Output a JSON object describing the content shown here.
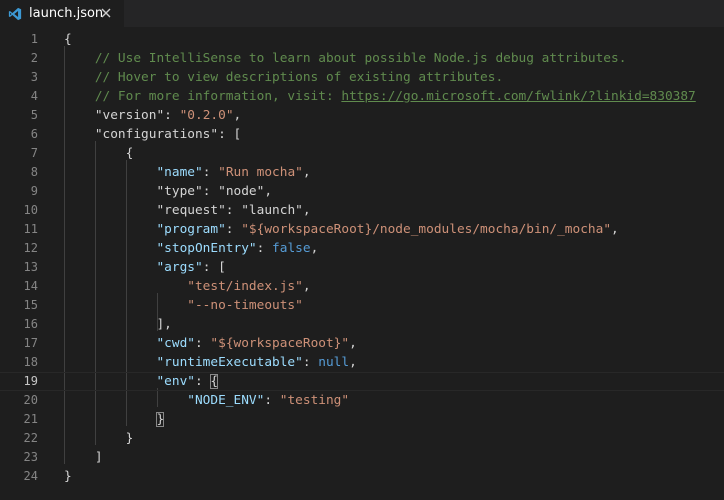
{
  "tab": {
    "filename": "launch.json",
    "icon": "vscode-logo-icon",
    "close_icon": "close-icon"
  },
  "colors": {
    "editor_bg": "#1e1e1e",
    "comment": "#608b4e",
    "key": "#9cdcfe",
    "string": "#ce9178",
    "keyword": "#569cd6",
    "line_number": "#858585"
  },
  "editor": {
    "current_line": 19,
    "lines": [
      {
        "n": "1",
        "tokens": [
          {
            "t": "{",
            "c": "p"
          }
        ]
      },
      {
        "n": "2",
        "tokens": [
          {
            "t": "    // Use IntelliSense to learn about possible Node.js debug attributes.",
            "c": "c"
          }
        ]
      },
      {
        "n": "3",
        "tokens": [
          {
            "t": "    // Hover to view descriptions of existing attributes.",
            "c": "c"
          }
        ]
      },
      {
        "n": "4",
        "tokens": [
          {
            "t": "    // For more information, visit: ",
            "c": "c"
          },
          {
            "t": "https://go.microsoft.com/fwlink/?linkid=830387",
            "c": "lnk"
          }
        ]
      },
      {
        "n": "5",
        "tokens": [
          {
            "t": "    \"version\"",
            "c": "p"
          },
          {
            "t": ": ",
            "c": "p"
          },
          {
            "t": "\"0.2.0\"",
            "c": "s"
          },
          {
            "t": ",",
            "c": "p"
          }
        ]
      },
      {
        "n": "6",
        "tokens": [
          {
            "t": "    \"configurations\"",
            "c": "p"
          },
          {
            "t": ": [",
            "c": "p"
          }
        ]
      },
      {
        "n": "7",
        "tokens": [
          {
            "t": "        {",
            "c": "p"
          }
        ]
      },
      {
        "n": "8",
        "tokens": [
          {
            "t": "            \"name\"",
            "c": "k"
          },
          {
            "t": ": ",
            "c": "p"
          },
          {
            "t": "\"Run mocha\"",
            "c": "s"
          },
          {
            "t": ",",
            "c": "p"
          }
        ]
      },
      {
        "n": "9",
        "tokens": [
          {
            "t": "            \"type\"",
            "c": "p"
          },
          {
            "t": ": ",
            "c": "p"
          },
          {
            "t": "\"node\"",
            "c": "p"
          },
          {
            "t": ",",
            "c": "p"
          }
        ]
      },
      {
        "n": "10",
        "tokens": [
          {
            "t": "            \"request\"",
            "c": "p"
          },
          {
            "t": ": ",
            "c": "p"
          },
          {
            "t": "\"launch\"",
            "c": "p"
          },
          {
            "t": ",",
            "c": "p"
          }
        ]
      },
      {
        "n": "11",
        "tokens": [
          {
            "t": "            \"program\"",
            "c": "k"
          },
          {
            "t": ": ",
            "c": "p"
          },
          {
            "t": "\"${workspaceRoot}/node_modules/mocha/bin/_mocha\"",
            "c": "s"
          },
          {
            "t": ",",
            "c": "p"
          }
        ]
      },
      {
        "n": "12",
        "tokens": [
          {
            "t": "            \"stopOnEntry\"",
            "c": "k"
          },
          {
            "t": ": ",
            "c": "p"
          },
          {
            "t": "false",
            "c": "kw"
          },
          {
            "t": ",",
            "c": "p"
          }
        ]
      },
      {
        "n": "13",
        "tokens": [
          {
            "t": "            \"args\"",
            "c": "k"
          },
          {
            "t": ": [",
            "c": "p"
          }
        ]
      },
      {
        "n": "14",
        "tokens": [
          {
            "t": "                \"test/index.js\"",
            "c": "s"
          },
          {
            "t": ",",
            "c": "p"
          }
        ]
      },
      {
        "n": "15",
        "tokens": [
          {
            "t": "                \"--no-timeouts\"",
            "c": "s"
          }
        ]
      },
      {
        "n": "16",
        "tokens": [
          {
            "t": "            ],",
            "c": "p"
          }
        ]
      },
      {
        "n": "17",
        "tokens": [
          {
            "t": "            \"cwd\"",
            "c": "k"
          },
          {
            "t": ": ",
            "c": "p"
          },
          {
            "t": "\"${workspaceRoot}\"",
            "c": "s"
          },
          {
            "t": ",",
            "c": "p"
          }
        ]
      },
      {
        "n": "18",
        "tokens": [
          {
            "t": "            \"runtimeExecutable\"",
            "c": "k"
          },
          {
            "t": ": ",
            "c": "p"
          },
          {
            "t": "null",
            "c": "kw"
          },
          {
            "t": ",",
            "c": "p"
          }
        ]
      },
      {
        "n": "19",
        "tokens": [
          {
            "t": "            \"env\"",
            "c": "k"
          },
          {
            "t": ": ",
            "c": "p"
          },
          {
            "t": "{",
            "c": "p",
            "match": true
          }
        ]
      },
      {
        "n": "20",
        "tokens": [
          {
            "t": "                \"NODE_ENV\"",
            "c": "k"
          },
          {
            "t": ": ",
            "c": "p"
          },
          {
            "t": "\"testing\"",
            "c": "s"
          }
        ]
      },
      {
        "n": "21",
        "tokens": [
          {
            "t": "            ",
            "c": "p"
          },
          {
            "t": "}",
            "c": "p",
            "match": true
          }
        ]
      },
      {
        "n": "22",
        "tokens": [
          {
            "t": "        }",
            "c": "p"
          }
        ]
      },
      {
        "n": "23",
        "tokens": [
          {
            "t": "    ]",
            "c": "p"
          }
        ]
      },
      {
        "n": "24",
        "tokens": [
          {
            "t": "}",
            "c": "p"
          }
        ]
      }
    ]
  }
}
